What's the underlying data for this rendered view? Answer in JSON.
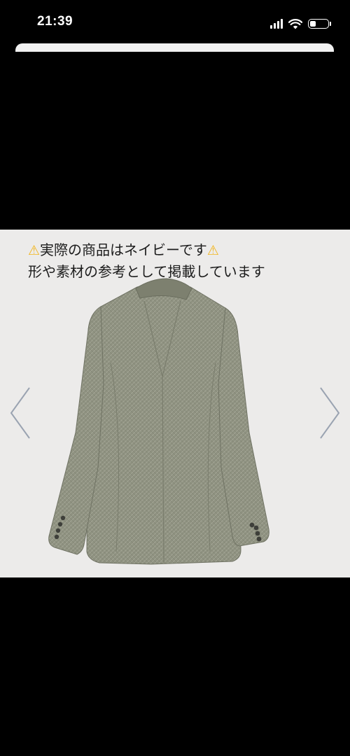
{
  "status_bar": {
    "time": "21:39",
    "signal_icon": "cellular-signal-icon",
    "wifi_icon": "wifi-icon",
    "battery_icon": "battery-icon",
    "battery_level": 0.35
  },
  "listing_image": {
    "caption_line1": "実際の商品はネイビーです",
    "caption_line2": "形や素材の参考として掲載しています",
    "warning_glyph": "⚠",
    "warning_icon": "warning-icon",
    "prev_icon": "chevron-left-icon",
    "next_icon": "chevron-right-icon",
    "product_image": "jacket-back-photo",
    "colors": {
      "panel_bg": "#ecebea",
      "warning": "#f2b51c",
      "jacket": "#8f9281"
    }
  }
}
